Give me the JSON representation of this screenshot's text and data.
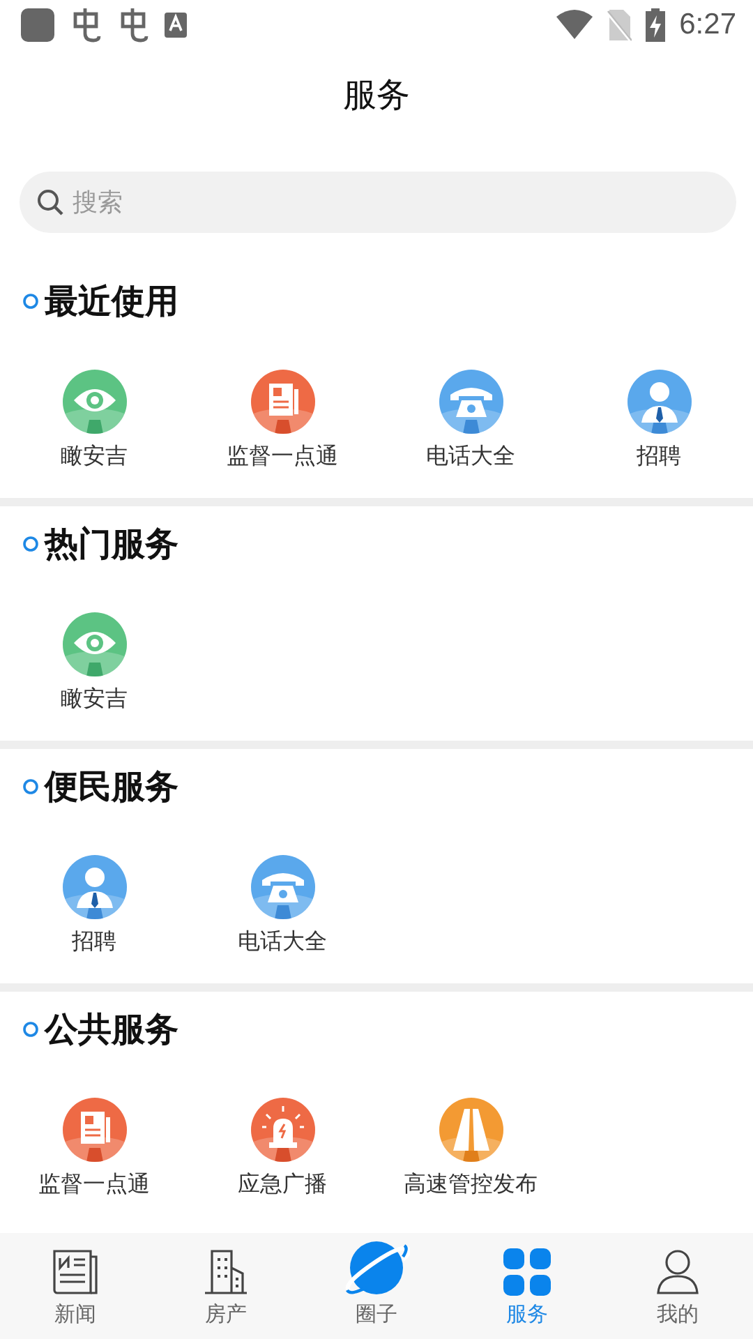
{
  "status_bar": {
    "time": "6:27"
  },
  "header": {
    "title": "服务"
  },
  "search": {
    "placeholder": "搜索"
  },
  "sections": [
    {
      "title": "最近使用",
      "items": [
        {
          "label": "瞰安吉",
          "kind": "eye"
        },
        {
          "label": "监督一点通",
          "kind": "document"
        },
        {
          "label": "电话大全",
          "kind": "phone"
        },
        {
          "label": "招聘",
          "kind": "person"
        }
      ]
    },
    {
      "title": "热门服务",
      "items": [
        {
          "label": "瞰安吉",
          "kind": "eye"
        }
      ]
    },
    {
      "title": "便民服务",
      "items": [
        {
          "label": "招聘",
          "kind": "person"
        },
        {
          "label": "电话大全",
          "kind": "phone"
        }
      ]
    },
    {
      "title": "公共服务",
      "items": [
        {
          "label": "监督一点通",
          "kind": "document"
        },
        {
          "label": "应急广播",
          "kind": "siren"
        },
        {
          "label": "高速管控发布",
          "kind": "road"
        }
      ]
    }
  ],
  "tab_bar": [
    {
      "label": "新闻",
      "kind": "news",
      "selected": false
    },
    {
      "label": "房产",
      "kind": "building",
      "selected": false
    },
    {
      "label": "圈子",
      "kind": "planet",
      "selected": false
    },
    {
      "label": "服务",
      "kind": "grid",
      "selected": true
    },
    {
      "label": "我的",
      "kind": "person",
      "selected": false
    }
  ]
}
